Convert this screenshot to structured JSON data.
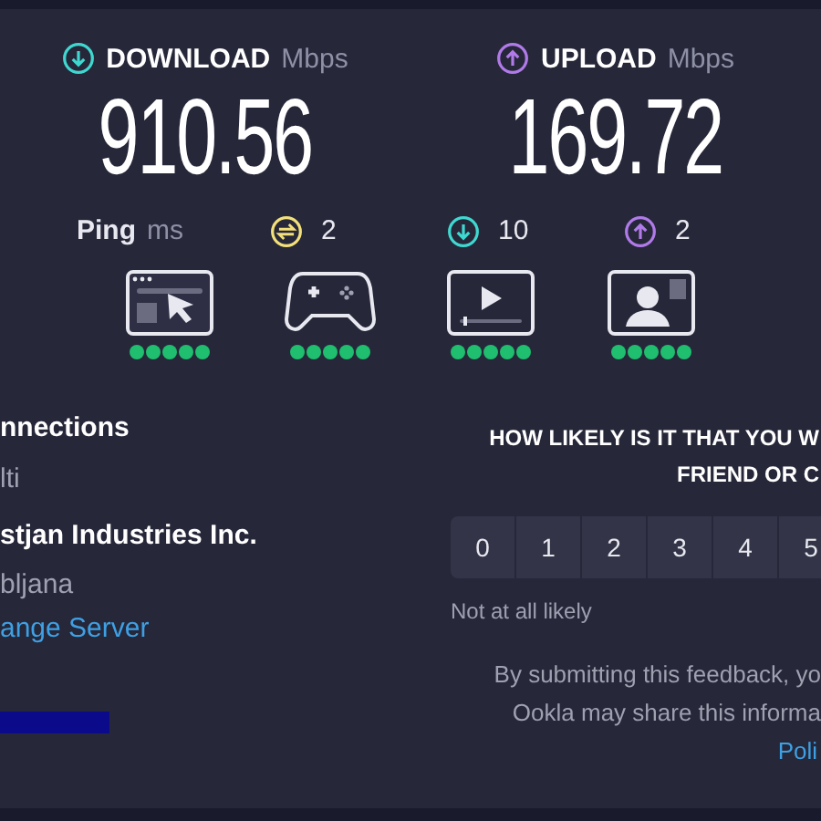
{
  "speeds": [
    {
      "kind": "download",
      "label": "DOWNLOAD",
      "unit": "Mbps",
      "value": "910.56"
    },
    {
      "kind": "upload",
      "label": "UPLOAD",
      "unit": "Mbps",
      "value": "169.72"
    }
  ],
  "ping": {
    "label": "Ping",
    "unit": "ms",
    "items": [
      {
        "kind": "idle",
        "value": "2"
      },
      {
        "kind": "download",
        "value": "10"
      },
      {
        "kind": "upload",
        "value": "2"
      }
    ]
  },
  "ratings": [
    {
      "kind": "browsing",
      "stars": 5
    },
    {
      "kind": "gaming",
      "stars": 5
    },
    {
      "kind": "streaming",
      "stars": 5
    },
    {
      "kind": "video-call",
      "stars": 5
    }
  ],
  "connections": {
    "label": "nnections",
    "value": "lti"
  },
  "server": {
    "name": "stjan Industries Inc.",
    "location": "bljana",
    "link": "ange Server"
  },
  "survey": {
    "question": [
      "HOW LIKELY IS IT THAT YOU W",
      "FRIEND OR C"
    ],
    "scale": [
      "0",
      "1",
      "2",
      "3",
      "4",
      "5"
    ],
    "low_label": "Not at all likely",
    "disclaimer": [
      "By submitting this feedback, yo",
      "Ookla may share this informa"
    ],
    "link": "Poli"
  }
}
